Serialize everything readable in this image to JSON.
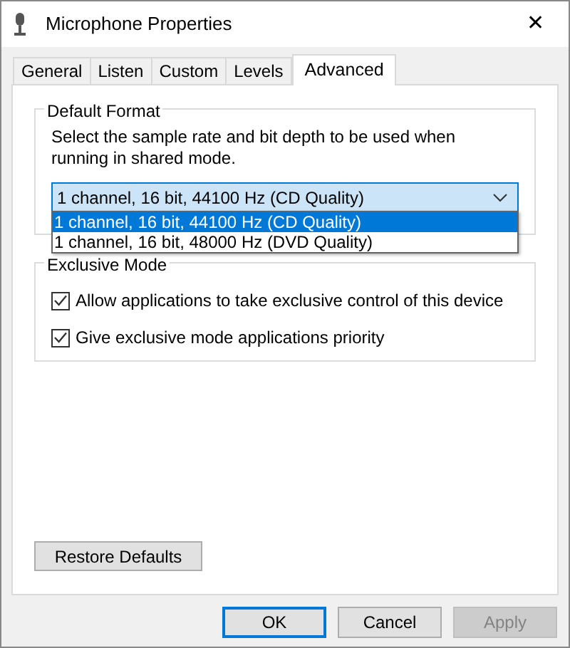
{
  "window": {
    "title": "Microphone Properties",
    "close": "✕"
  },
  "tabs": [
    {
      "label": "General",
      "selected": false
    },
    {
      "label": "Listen",
      "selected": false
    },
    {
      "label": "Custom",
      "selected": false
    },
    {
      "label": "Levels",
      "selected": false
    },
    {
      "label": "Advanced",
      "selected": true
    }
  ],
  "default_format": {
    "title": "Default Format",
    "description": "Select the sample rate and bit depth to be used when running in shared mode.",
    "dropdown": {
      "value": "1 channel, 16 bit, 44100 Hz (CD Quality)",
      "expanded": true,
      "options": [
        {
          "label": "1 channel, 16 bit, 44100 Hz (CD Quality)",
          "selected": true
        },
        {
          "label": "1 channel, 16 bit, 48000 Hz (DVD Quality)",
          "selected": false
        }
      ]
    }
  },
  "exclusive_mode": {
    "title": "Exclusive Mode",
    "options": [
      {
        "label": "Allow applications to take exclusive control of this device",
        "checked": true
      },
      {
        "label": "Give exclusive mode applications priority",
        "checked": true
      }
    ]
  },
  "restore_button": {
    "label": "Restore Defaults"
  },
  "buttons": [
    {
      "label": "OK",
      "default": true,
      "disabled": false
    },
    {
      "label": "Cancel",
      "default": false,
      "disabled": false
    },
    {
      "label": "Apply",
      "default": false,
      "disabled": true
    }
  ]
}
